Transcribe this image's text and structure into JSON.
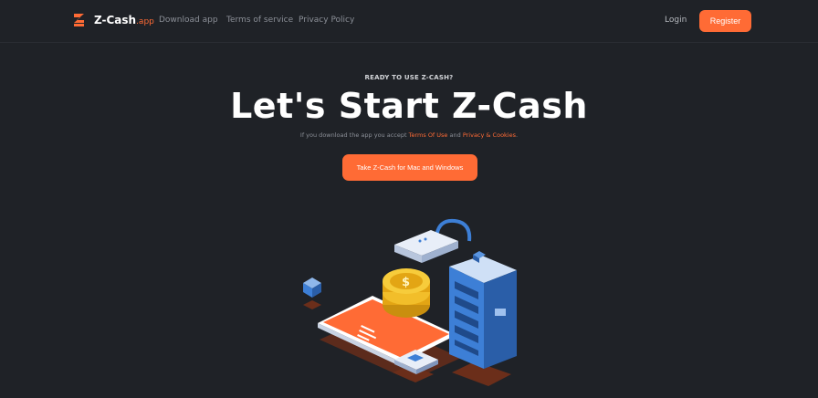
{
  "nav": {
    "brand": "Z-Cash",
    "brand_suffix": ".app",
    "links": [
      "Download app",
      "Terms of service",
      "Privacy Policy"
    ],
    "login": "Login",
    "register": "Register"
  },
  "hero": {
    "eyebrow": "READY TO USE Z-CASH?",
    "title": "Let's Start Z-Cash",
    "sub_prefix": "If you download the app you accept ",
    "terms_link": "Terms Of Use",
    "sub_and": " and ",
    "privacy_link": "Privacy & Cookies",
    "sub_suffix": ".",
    "cta": "Take Z-Cash for Mac and Windows"
  },
  "colors": {
    "accent": "#ff6b35",
    "background": "#1f2227",
    "blue": "#3d7fd6"
  }
}
